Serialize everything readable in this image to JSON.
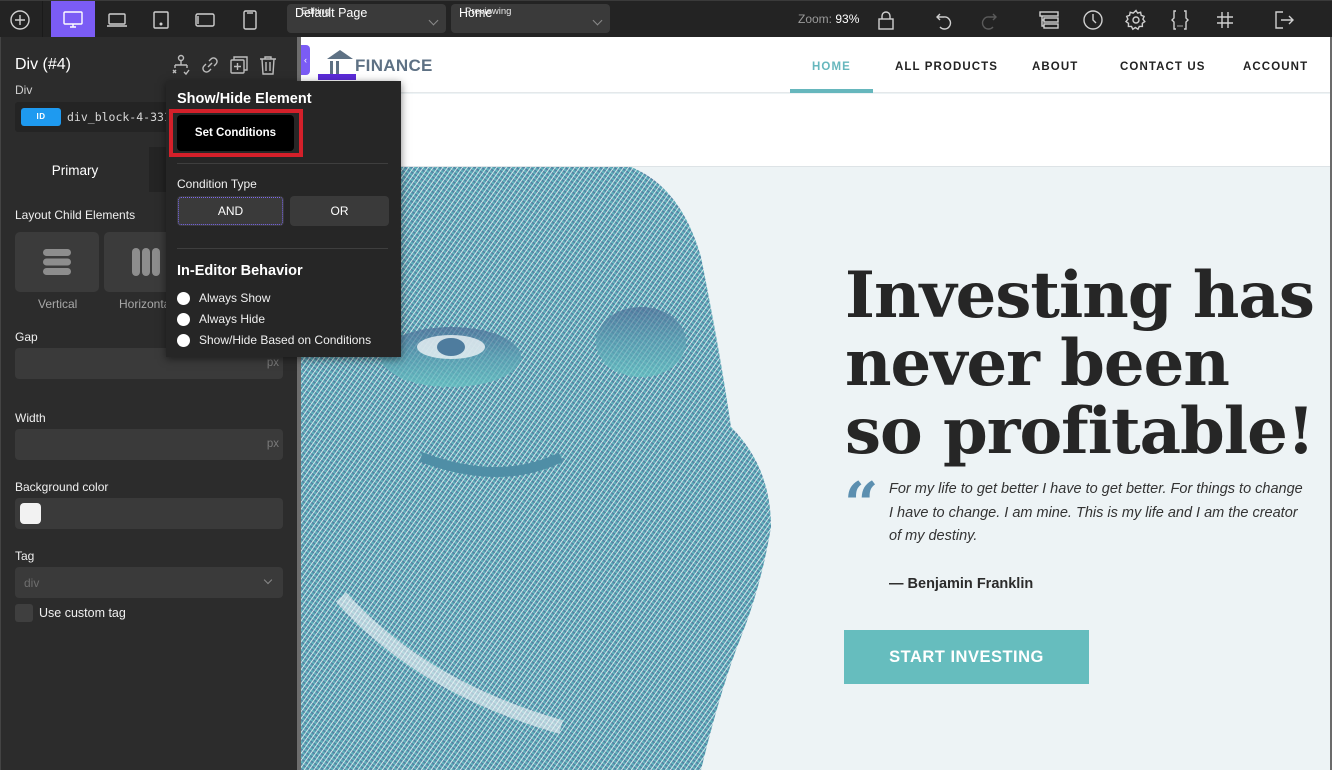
{
  "topbar": {
    "add_icon": "plus-circle-icon",
    "devices": [
      {
        "name": "desktop",
        "icon": "monitor-icon",
        "active": true
      },
      {
        "name": "laptop",
        "icon": "laptop-icon",
        "active": false
      },
      {
        "name": "tablet",
        "icon": "tablet-icon",
        "active": false
      },
      {
        "name": "mobile-landscape",
        "icon": "phone-landscape-icon",
        "active": false
      },
      {
        "name": "mobile",
        "icon": "phone-icon",
        "active": false
      }
    ],
    "editing": {
      "label": "Editing",
      "value": "Default Page"
    },
    "previewing": {
      "label": "Previewing",
      "value": "Home"
    },
    "zoom_label": "Zoom:",
    "zoom_value": "93%",
    "right_icons": [
      "lock-icon",
      "undo-icon",
      "redo-icon",
      "structure-icon",
      "history-icon",
      "settings-icon",
      "code-icon",
      "grid-icon",
      "exit-icon"
    ]
  },
  "left_panel": {
    "title": "Div (#4)",
    "element_type": "Div",
    "id_badge": "ID",
    "id_value": "div_block-4-331",
    "actions": [
      "structure-icon",
      "link-icon",
      "duplicate-icon",
      "trash-icon"
    ],
    "tabs": [
      {
        "label": "Primary",
        "active": true
      }
    ],
    "layout_label": "Layout Child Elements",
    "layout_options": [
      {
        "label": "Vertical"
      },
      {
        "label": "Horizontal"
      }
    ],
    "gap_label": "Gap",
    "gap_value": "",
    "gap_unit": "px",
    "width_label": "Width",
    "width_value": "",
    "width_unit": "px",
    "bg_label": "Background color",
    "bg_color": "#f2f2f2",
    "tag_label": "Tag",
    "tag_value": "div",
    "custom_tag_label": "Use custom tag"
  },
  "popover": {
    "title": "Show/Hide Element",
    "set_conditions": "Set Conditions",
    "condition_type_label": "Condition Type",
    "condition_types": [
      "AND",
      "OR"
    ],
    "condition_selected": "AND",
    "behavior_title": "In-Editor Behavior",
    "behavior_options": [
      "Always Show",
      "Always Hide",
      "Show/Hide Based on Conditions"
    ]
  },
  "site": {
    "logo_text": "FINANCE",
    "nav": [
      {
        "label": "HOME",
        "active": true
      },
      {
        "label": "ALL PRODUCTS",
        "active": false
      },
      {
        "label": "ABOUT",
        "active": false
      },
      {
        "label": "CONTACT US",
        "active": false
      },
      {
        "label": "ACCOUNT",
        "active": false
      }
    ],
    "headline": [
      "Investing has",
      "never been",
      "so profitable!"
    ],
    "quote_mark": "“",
    "quote": "For my life to get better I have to get better. For things to change I have to change. I am mine. This is my life and I am the creator of my destiny.",
    "author": "— Benjamin Franklin",
    "cta": "START INVESTING",
    "accent": "#66b7bd"
  }
}
